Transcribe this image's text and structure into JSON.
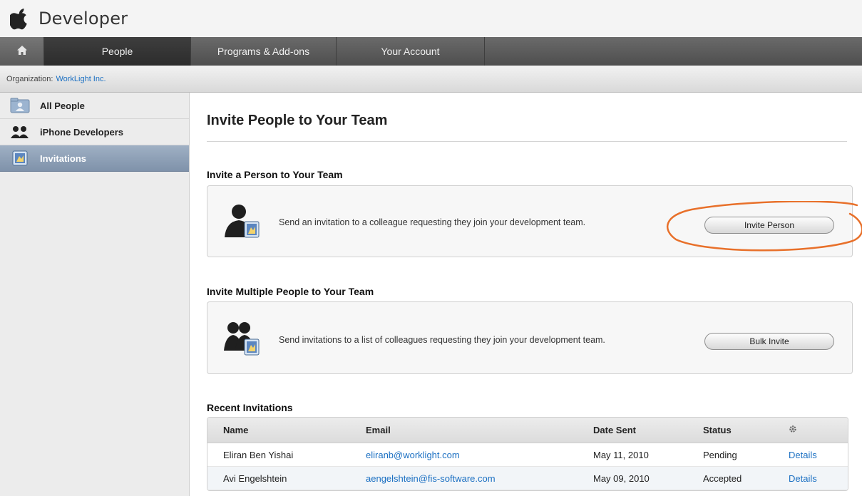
{
  "header": {
    "brand_name": "Developer"
  },
  "nav": {
    "tabs": [
      {
        "label": "People",
        "active": true
      },
      {
        "label": "Programs & Add-ons",
        "active": false
      },
      {
        "label": "Your Account",
        "active": false
      }
    ]
  },
  "org_bar": {
    "label": "Organization:",
    "org_name": "WorkLight Inc."
  },
  "sidebar": {
    "items": [
      {
        "label": "All People",
        "icon": "folder-person-icon",
        "active": false
      },
      {
        "label": "iPhone Developers",
        "icon": "group-icon",
        "active": false
      },
      {
        "label": "Invitations",
        "icon": "invitation-icon",
        "active": true
      }
    ]
  },
  "main": {
    "page_title": "Invite People to Your Team",
    "invite_person": {
      "section_title": "Invite a Person to Your Team",
      "description": "Send an invitation to a colleague requesting they join your development team.",
      "button_label": "Invite Person"
    },
    "invite_multiple": {
      "section_title": "Invite Multiple People to Your Team",
      "description": "Send invitations to a list of colleagues requesting they join your development team.",
      "button_label": "Bulk Invite"
    },
    "recent": {
      "section_title": "Recent Invitations",
      "columns": [
        "Name",
        "Email",
        "Date Sent",
        "Status"
      ],
      "rows": [
        {
          "name": "Eliran Ben Yishai",
          "email": "eliranb@worklight.com",
          "date": "May 11, 2010",
          "status": "Pending",
          "action": "Details"
        },
        {
          "name": "Avi Engelshtein",
          "email": "aengelshtein@fis-software.com",
          "date": "May 09, 2010",
          "status": "Accepted",
          "action": "Details"
        }
      ]
    }
  },
  "colors": {
    "link": "#1a6fc2",
    "annotation": "#e8702a",
    "nav_bg": "#5a5a5a",
    "sidebar_active": "#8a9cb3"
  }
}
